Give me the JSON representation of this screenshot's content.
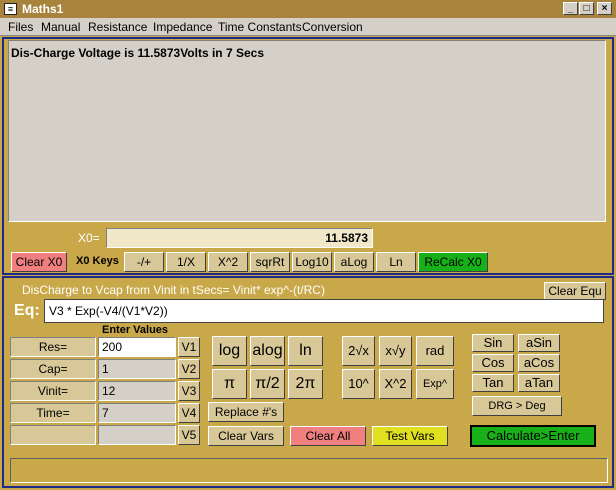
{
  "window": {
    "title": "Maths1",
    "app_icon": "calc-icon",
    "controls": [
      "minimize",
      "maximize",
      "close"
    ]
  },
  "menu": [
    "Files",
    "Manual",
    "Resistance",
    "Impedance",
    "Time Constants",
    "Conversion"
  ],
  "display": {
    "text": "Dis-Charge Voltage is 11.5873Volts in 7 Secs"
  },
  "x0": {
    "label": "X0=",
    "value": "11.5873"
  },
  "x0_keys": {
    "clear_label": "Clear X0",
    "keys_label": "X0 Keys",
    "buttons": [
      "-/+",
      "1/X",
      "X^2",
      "sqrRt",
      "Log10",
      "aLog",
      "Ln"
    ],
    "recalc_label": "ReCalc X0"
  },
  "equation": {
    "description": "DisCharge to Vcap from Vinit in tSecs= Vinit* exp^-(t/RC)",
    "clear_label": "Clear Equ",
    "eq_label": "Eq:",
    "value": "V3 * Exp(-V4/(V1*V2))"
  },
  "values": {
    "header": "Enter Values",
    "rows": [
      {
        "name": "Res=",
        "value": "200",
        "var": "V1"
      },
      {
        "name": "Cap=",
        "value": "1",
        "var": "V2"
      },
      {
        "name": "Vinit=",
        "value": "12",
        "var": "V3"
      },
      {
        "name": "Time=",
        "value": "7",
        "var": "V4"
      },
      {
        "name": "",
        "value": "",
        "var": "V5"
      }
    ]
  },
  "func_buttons": {
    "log": "log",
    "alog": "alog",
    "ln": "ln",
    "pi": "π",
    "pi2": "π/2",
    "twopi": "2π",
    "replace": "Replace #'s",
    "clear_vars": "Clear Vars",
    "clear_all": "Clear All",
    "test_vars": "Test Vars",
    "root2": "2√x",
    "rooty": "x√y",
    "rad": "rad",
    "pow10": "10^",
    "xpow2": "X^2",
    "exp": "Exp^",
    "calc": "Calculate>Enter"
  },
  "trig": {
    "sin": "Sin",
    "asin": "aSin",
    "cos": "Cos",
    "acos": "aCos",
    "tan": "Tan",
    "atan": "aTan",
    "drg": "DRG > Deg"
  },
  "colors": {
    "background": "#c8a848",
    "titlebar": "#a8833c",
    "panel_border": "#1c2a8c",
    "green": "#18b018",
    "red": "#f08080",
    "yellow": "#e0e020"
  }
}
